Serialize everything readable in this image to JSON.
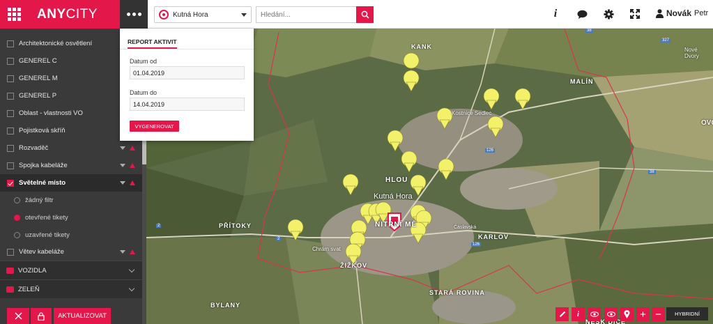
{
  "app": {
    "brand_bold": "ANY",
    "brand_rest": "CITY"
  },
  "header": {
    "city_select": "Kutná Hora",
    "search_placeholder": "Hledání...",
    "user_last": "Novák",
    "user_first": "Petr"
  },
  "report": {
    "title": "REPORT AKTIVIT",
    "date_from_label": "Datum od",
    "date_from_value": "01.04.2019",
    "date_to_label": "Datum do",
    "date_to_value": "14.04.2019",
    "generate_label": "VYGENEROVAT"
  },
  "sidebar": {
    "layers": [
      "Architektonické osvětlení",
      "GENEREL C",
      "GENEREL M",
      "GENEREL P",
      "Oblast - vlastnosti VO",
      "Pojistková skříň",
      "Rozvaděč",
      "Spojka kabeláže",
      "Světelné místo",
      "Větev kabeláže"
    ],
    "filters": [
      "žádný filtr",
      "otevřené tikety",
      "uzavřené tikety"
    ],
    "groups": [
      "VOZIDLA",
      "ZELEŇ"
    ],
    "update_label": "AKTUALIZOVAT"
  },
  "map": {
    "place_labels": [
      "KANK",
      "MALÍN",
      "Kostnice Sedlec",
      "HLOU",
      "Kutná Hora",
      "NITRNÍ MĚ",
      "PŘÍTOKY",
      "KARLOV",
      "Chrám svat",
      "ŽIŽKOV",
      "STARÁ ROVINA",
      "BYLANY",
      "NESK DICE",
      "Nové Dvory",
      "OVČ",
      "Čáslavská"
    ],
    "road_numbers": [
      "2",
      "126",
      "38",
      "327",
      "2",
      "126",
      "38"
    ],
    "hybrid_label": "HYBRIDNÍ"
  },
  "colors": {
    "accent": "#e4174a",
    "sidebar": "#3a3a3a",
    "marker": "#f3f06a"
  }
}
